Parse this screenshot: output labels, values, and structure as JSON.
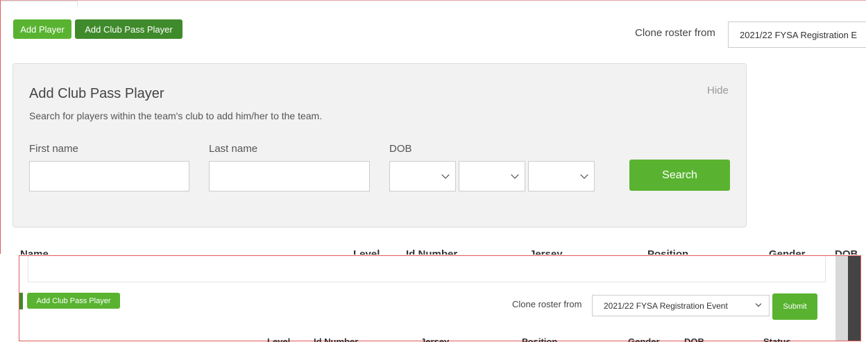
{
  "toolbar": {
    "add_player": "Add Player",
    "add_club_pass_player": "Add Club Pass Player",
    "clone_label": "Clone roster from",
    "clone_value": "2021/22 FYSA Registration E"
  },
  "panel": {
    "title": "Add Club Pass Player",
    "hide": "Hide",
    "description": "Search for players within the team's club to add him/her to the team.",
    "first_name_label": "First name",
    "last_name_label": "Last name",
    "dob_label": "DOB",
    "search_button": "Search"
  },
  "table_headers_top": [
    "Name",
    "Level",
    "Id Number",
    "Jersey",
    "Position",
    "Gender",
    "DOB"
  ],
  "second": {
    "add_club_pass_player": "Add Club Pass Player",
    "clone_label": "Clone roster from",
    "clone_value": "2021/22 FYSA Registration Event",
    "submit": "Submit",
    "table_headers": [
      "Level",
      "Id Number",
      "Jersey",
      "Position",
      "Gender",
      "DOB",
      "Status"
    ]
  },
  "colors": {
    "green": "#59b330",
    "dark_green": "#3f8a2b",
    "frame_red": "#e05a5a"
  }
}
